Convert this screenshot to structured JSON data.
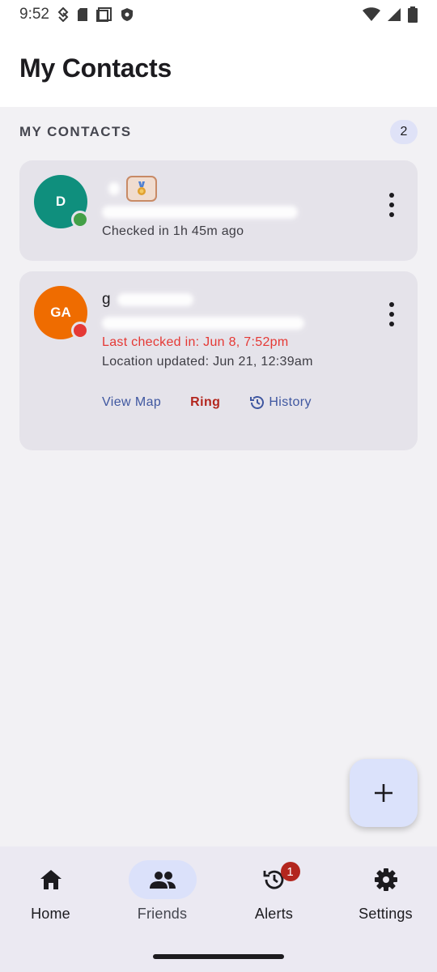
{
  "status_bar": {
    "time": "9:52"
  },
  "header": {
    "title": "My Contacts"
  },
  "section": {
    "title": "MY CONTACTS",
    "count": "2"
  },
  "contacts": [
    {
      "initials": "D",
      "name": "",
      "email": "",
      "status_color": "#43a047",
      "avatar_color": "#0f8f7d",
      "info": "Checked in 1h 45m ago"
    },
    {
      "initials": "GA",
      "name": "g",
      "email": "",
      "status_color": "#e53935",
      "avatar_color": "#ef6c00",
      "alert": "Last checked in: Jun 8, 7:52pm",
      "location": "Location updated: Jun 21, 12:39am",
      "actions": {
        "map": "View Map",
        "ring": "Ring",
        "history": "History"
      }
    }
  ],
  "nav": {
    "items": [
      {
        "label": "Home",
        "icon": "home-icon"
      },
      {
        "label": "Friends",
        "icon": "people-icon",
        "active": true
      },
      {
        "label": "Alerts",
        "icon": "history-alert-icon",
        "badge": "1"
      },
      {
        "label": "Settings",
        "icon": "gear-icon"
      }
    ]
  },
  "colors": {
    "accent": "#3f57a0",
    "alert": "#e53935",
    "ring": "#b3261e",
    "fab": "#dbe2fb"
  }
}
